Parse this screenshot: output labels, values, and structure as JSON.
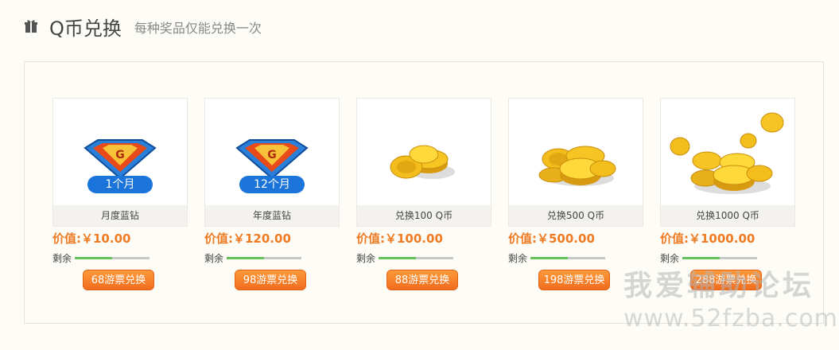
{
  "header": {
    "title": "Q币兑换",
    "subtitle": "每种奖品仅能兑换一次"
  },
  "colors": {
    "accent": "#f07a22",
    "progress": "#65c25c",
    "button": "#f57c22"
  },
  "items": [
    {
      "icon": "blue-diamond-icon",
      "badge": "1个月",
      "name": "月度蓝钻",
      "price": "价值:￥10.00",
      "remain_label": "剩余",
      "remaining": 0.5,
      "button": "68游票兑换"
    },
    {
      "icon": "blue-diamond-icon",
      "badge": "12个月",
      "name": "年度蓝钻",
      "price": "价值:￥120.00",
      "remain_label": "剩余",
      "remaining": 0.5,
      "button": "98游票兑换"
    },
    {
      "icon": "gold-coins-icon",
      "badge": "",
      "name": "兑换100 Q币",
      "price": "价值:￥100.00",
      "remain_label": "剩余",
      "remaining": 0.5,
      "button": "88游票兑换"
    },
    {
      "icon": "gold-coins-icon",
      "badge": "",
      "name": "兑换500 Q币",
      "price": "价值:￥500.00",
      "remain_label": "剩余",
      "remaining": 0.5,
      "button": "198游票兑换"
    },
    {
      "icon": "gold-coins-icon",
      "badge": "",
      "name": "兑换1000 Q币",
      "price": "价值:￥1000.00",
      "remain_label": "剩余",
      "remaining": 0.5,
      "button": "288游票兑换"
    }
  ],
  "watermark": {
    "line1": "我爱辅助论坛",
    "line2": "www.52fzba.com"
  }
}
